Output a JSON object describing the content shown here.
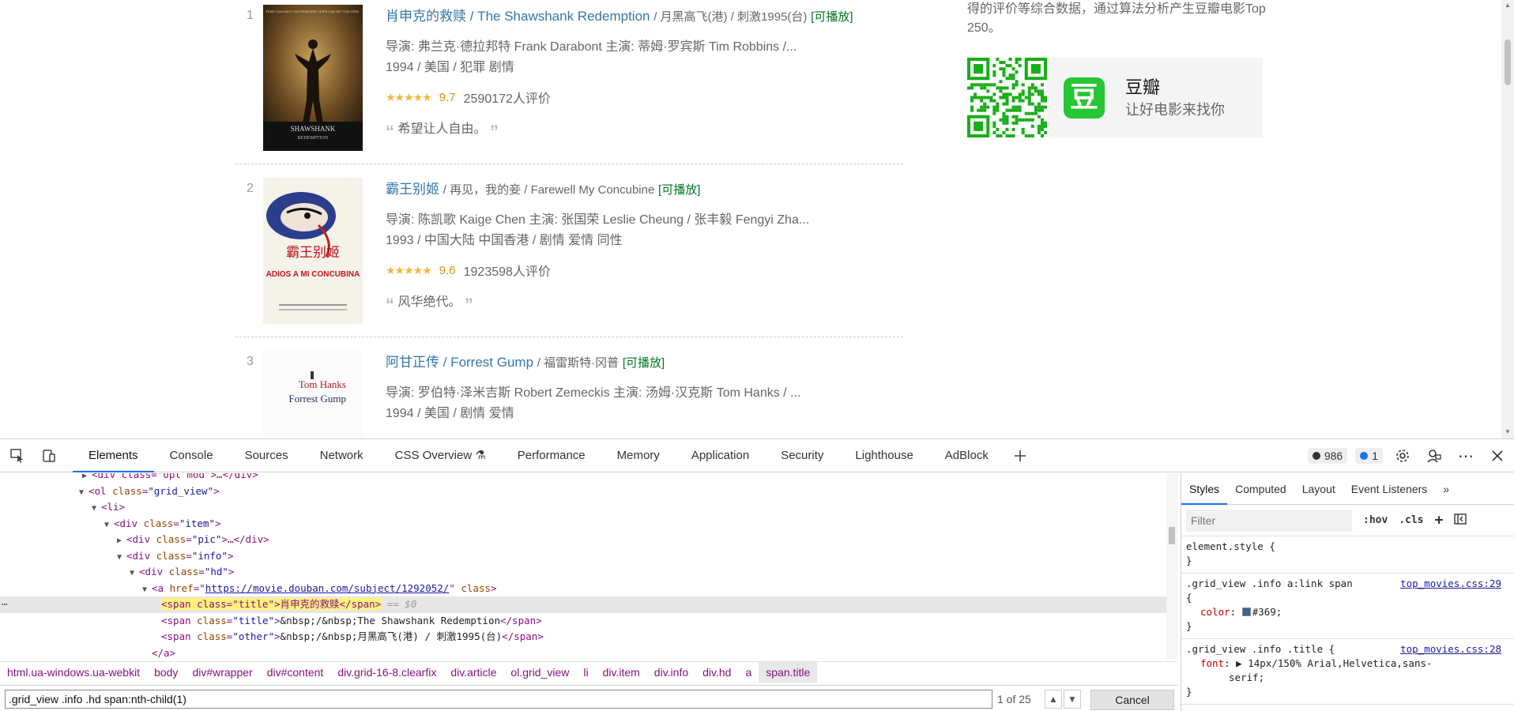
{
  "webpage": {
    "movies": [
      {
        "rank": "1",
        "title_cn": "肖申克的救赎",
        "title_en": "/ The Shawshank Redemption",
        "other": "/ 月黑高飞(港) / 刺激1995(台)",
        "playable": "[可播放]",
        "credits": "导演: 弗兰克·德拉邦特 Frank Darabont   主演: 蒂姆·罗宾斯 Tim Robbins /...",
        "meta": "1994 / 美国 / 犯罪 剧情",
        "stars": "★★★★★",
        "score": "9.7",
        "votes": "2590172人评价",
        "quote": "希望让人自由。"
      },
      {
        "rank": "2",
        "title_cn": "霸王别姬",
        "title_en": "",
        "other": "/ 再见，我的妾 / Farewell My Concubine",
        "playable": "[可播放]",
        "credits": "导演: 陈凯歌 Kaige Chen   主演: 张国荣 Leslie Cheung / 张丰毅 Fengyi Zha...",
        "meta": "1993 / 中国大陆 中国香港 / 剧情 爱情 同性",
        "stars": "★★★★★",
        "score": "9.6",
        "votes": "1923598人评价",
        "quote": "风华绝代。"
      },
      {
        "rank": "3",
        "title_cn": "阿甘正传",
        "title_en": "/ Forrest Gump",
        "other": "/ 福雷斯特·冈普",
        "playable": "[可播放]",
        "credits": "导演: 罗伯特·泽米吉斯 Robert Zemeckis   主演: 汤姆·汉克斯 Tom Hanks / ...",
        "meta": "1994 / 美国 / 剧情 爱情"
      }
    ],
    "sidebar_text": "得的评价等综合数据，通过算法分析产生豆瓣电影Top 250。",
    "app_logo": "豆",
    "app_name": "豆瓣",
    "app_slogan": "让好电影来找你",
    "poster1_title": "SHAWSHANK",
    "poster1_sub": "REDEMPTION",
    "poster1_tagline": "FEAR CAN HOLD YOU PRISONER. HOPE CAN SET YOU FREE.",
    "poster2_cn": "霸王别姬",
    "poster2_en": "ADIOS A MI CONCUBINA",
    "poster3_name": "Tom Hanks",
    "poster3_title": "Forrest Gump"
  },
  "devtools": {
    "tabs": [
      "Elements",
      "Console",
      "Sources",
      "Network",
      "CSS Overview ⚗",
      "Performance",
      "Memory",
      "Application",
      "Security",
      "Lighthouse",
      "AdBlock"
    ],
    "errors_count": "986",
    "messages_count": "1",
    "dom_lines": {
      "l0_tag": "<div class=\"opt mod\">…</div>",
      "l1_open": "<ol ",
      "l1_attr": "class",
      "l1_val": "\"grid_view\"",
      "l2": "<li>",
      "l3_open": "<div ",
      "l3_attr": "class",
      "l3_val": "\"item\"",
      "l4_open": "<div ",
      "l4_attr": "class",
      "l4_val": "\"pic\"",
      "l4_end": ">…</div>",
      "l5_open": "<div ",
      "l5_attr": "class",
      "l5_val": "\"info\"",
      "l6_open": "<div ",
      "l6_attr": "class",
      "l6_val": "\"hd\"",
      "l7_open": "<a ",
      "l7_attr": "href",
      "l7_link": "https://movie.douban.com/subject/1292052/",
      "l7_attr2": " class",
      "l8_hl": "<span class=\"title\">肖申克的救赎</span>",
      "l8_eq": "== $0",
      "l9_open": "<span ",
      "l9_attr": "class",
      "l9_val": "\"title\"",
      "l9_text": "&nbsp;/&nbsp;The Shawshank Redemption",
      "l9_close": "</span>",
      "l10_open": "<span ",
      "l10_attr": "class",
      "l10_val": "\"other\"",
      "l10_text": "&nbsp;/&nbsp;月黑高飞(港) / 刺激1995(台)",
      "l10_close": "</span>",
      "l11": "</a>"
    },
    "breadcrumbs": [
      "html.ua-windows.ua-webkit",
      "body",
      "div#wrapper",
      "div#content",
      "div.grid-16-8.clearfix",
      "div.article",
      "ol.grid_view",
      "li",
      "div.item",
      "div.info",
      "div.hd",
      "a",
      "span.title"
    ],
    "search_value": ".grid_view .info .hd span:nth-child(1)",
    "search_count": "1 of 25",
    "cancel_label": "Cancel",
    "styles": {
      "tabs": [
        "Styles",
        "Computed",
        "Layout",
        "Event Listeners"
      ],
      "filter_placeholder": "Filter",
      "hov": ":hov",
      "cls": ".cls",
      "rule0_selector": "element.style {",
      "rule0_close": "}",
      "rule1_selector": ".grid_view .info a:link span",
      "rule1_source": "top_movies.css:29",
      "rule1_open": "{",
      "rule1_prop": "color",
      "rule1_value": "#369;",
      "rule1_close": "}",
      "rule2_selector": ".grid_view .info .title {",
      "rule2_source": "top_movies.css:28",
      "rule2_prop": "font",
      "rule2_value": "▶ 14px/150% Arial,Helvetica,sans-",
      "rule2_value2": "serif;",
      "rule2_close": "}"
    }
  },
  "colors": {
    "link_blue": "#336699",
    "playable_green": "#007722",
    "star_gold": "#f3b73d",
    "devtools_accent": "#1a73e8"
  }
}
